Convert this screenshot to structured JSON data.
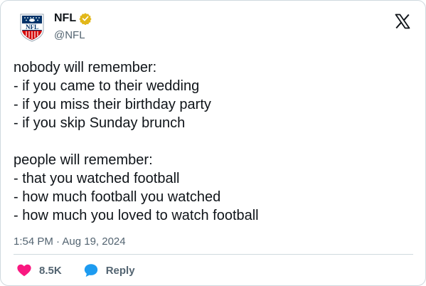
{
  "author": {
    "display_name": "NFL",
    "handle": "@NFL",
    "avatar_icon": "nfl-shield-logo",
    "verified_icon": "gold-verified-badge"
  },
  "tweet": {
    "lines": [
      "nobody will remember:",
      "- if you came to their wedding",
      "- if you miss their birthday party",
      "- if you skip Sunday brunch",
      "",
      "people will remember:",
      "- that you watched football",
      "- how much football you watched",
      "- how much you loved to watch football"
    ],
    "timestamp": "1:54 PM · Aug 19, 2024"
  },
  "actions": {
    "like_count": "8.5K",
    "reply_label": "Reply"
  },
  "colors": {
    "heart": "#f91880",
    "reply": "#1d9bf0",
    "verified": "#e2b719",
    "nfl_blue": "#013369",
    "nfl_red": "#d50a0a"
  }
}
